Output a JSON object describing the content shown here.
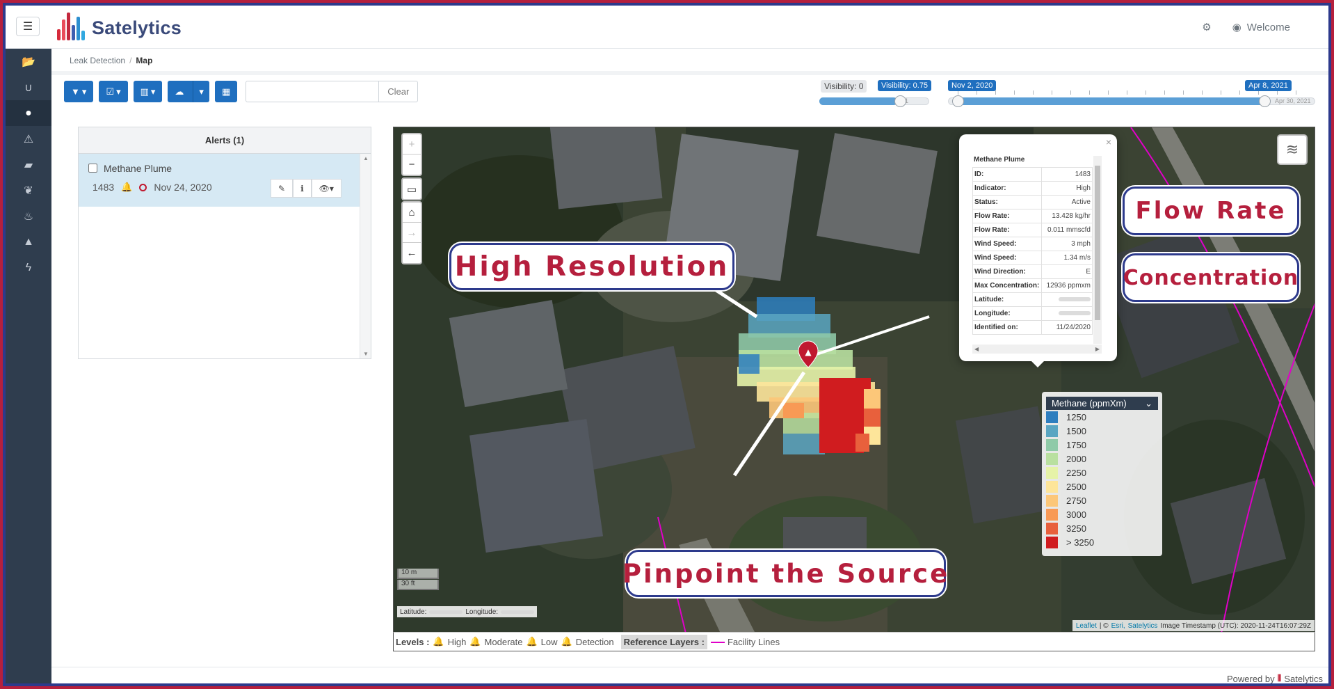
{
  "app": {
    "name": "Satelytics",
    "welcome": "Welcome"
  },
  "sidebar": {
    "items": [
      {
        "icon": "folder-open-icon",
        "glyph": "📂"
      },
      {
        "icon": "magnet-icon",
        "glyph": "∪"
      },
      {
        "icon": "droplet-icon",
        "glyph": "💧"
      },
      {
        "icon": "warning-icon",
        "glyph": "⚠"
      },
      {
        "icon": "building-icon",
        "glyph": "▰"
      },
      {
        "icon": "leaf-icon",
        "glyph": "❦"
      },
      {
        "icon": "thermometer-icon",
        "glyph": "🌡"
      },
      {
        "icon": "tree-icon",
        "glyph": "▲"
      },
      {
        "icon": "bolt-icon",
        "glyph": "ϟ"
      }
    ]
  },
  "breadcrumb": {
    "parent": "Leak Detection",
    "current": "Map"
  },
  "toolbar": {
    "search_value": "",
    "search_placeholder": "",
    "clear_label": "Clear"
  },
  "visibility": {
    "min_tag": "Visibility: 0",
    "value_tag": "Visibility: 0.75",
    "value": 0.75,
    "min": "0",
    "max": "1"
  },
  "timeline": {
    "start_tag": "Nov 2, 2020",
    "end_tag": "Apr 8, 2021",
    "max_label": "Apr 30, 2021"
  },
  "alerts": {
    "header": "Alerts (1)",
    "items": [
      {
        "name": "Methane Plume",
        "id": "1483",
        "date": "Nov 24, 2020"
      }
    ]
  },
  "popup": {
    "title": "Methane Plume",
    "rows": [
      {
        "k": "ID:",
        "v": "1483"
      },
      {
        "k": "Indicator:",
        "v": "High"
      },
      {
        "k": "Status:",
        "v": "Active"
      },
      {
        "k": "Flow Rate:",
        "v": "13.428 kg/hr"
      },
      {
        "k": "Flow Rate:",
        "v": "0.011 mmscfd"
      },
      {
        "k": "Wind Speed:",
        "v": "3 mph"
      },
      {
        "k": "Wind Speed:",
        "v": "1.34 m/s"
      },
      {
        "k": "Wind Direction:",
        "v": "E"
      },
      {
        "k": "Max Concentration:",
        "v": "12936 ppmxm"
      },
      {
        "k": "Latitude:",
        "v": ""
      },
      {
        "k": "Longitude:",
        "v": ""
      },
      {
        "k": "Identified on:",
        "v": "11/24/2020"
      }
    ]
  },
  "legend": {
    "title": "Methane (ppmXm)",
    "items": [
      {
        "label": "1250",
        "color": "#2e7fbf"
      },
      {
        "label": "1500",
        "color": "#5aa6c2"
      },
      {
        "label": "1750",
        "color": "#8fcaa8"
      },
      {
        "label": "2000",
        "color": "#b9e0a0"
      },
      {
        "label": "2250",
        "color": "#e6f3a8"
      },
      {
        "label": "2500",
        "color": "#fde59a"
      },
      {
        "label": "2750",
        "color": "#fcc779"
      },
      {
        "label": "3000",
        "color": "#f89a55"
      },
      {
        "label": "3250",
        "color": "#e8603c"
      },
      {
        "label": "> 3250",
        "color": "#d01c1f"
      }
    ]
  },
  "map": {
    "scale_m": "10 m",
    "scale_ft": "30 ft",
    "lat_label": "Latitude:",
    "lon_label": "Longitude:",
    "attribution_leaflet": "Leaflet",
    "attribution_sep": "| ©",
    "attribution_esri": "Esri,",
    "attribution_sat": "Satelytics",
    "timestamp": "Image Timestamp (UTC): 2020-11-24T16:07:29Z"
  },
  "levels": {
    "label": "Levels :",
    "high": "High",
    "moderate": "Moderate",
    "low": "Low",
    "detection": "Detection",
    "ref_label": "Reference Layers :",
    "facility": "Facility Lines"
  },
  "footer": {
    "powered": "Powered by",
    "brand": "Satelytics"
  },
  "callouts": {
    "high_res": "High Resolution",
    "flow_rate": "Flow Rate",
    "concentration": "Concentration",
    "pinpoint": "Pinpoint the Source"
  },
  "colors": {
    "brand_red": "#b51f3d",
    "brand_blue": "#2d3a8c",
    "primary": "#1f6fbf",
    "sidebar": "#2f3d4e"
  }
}
